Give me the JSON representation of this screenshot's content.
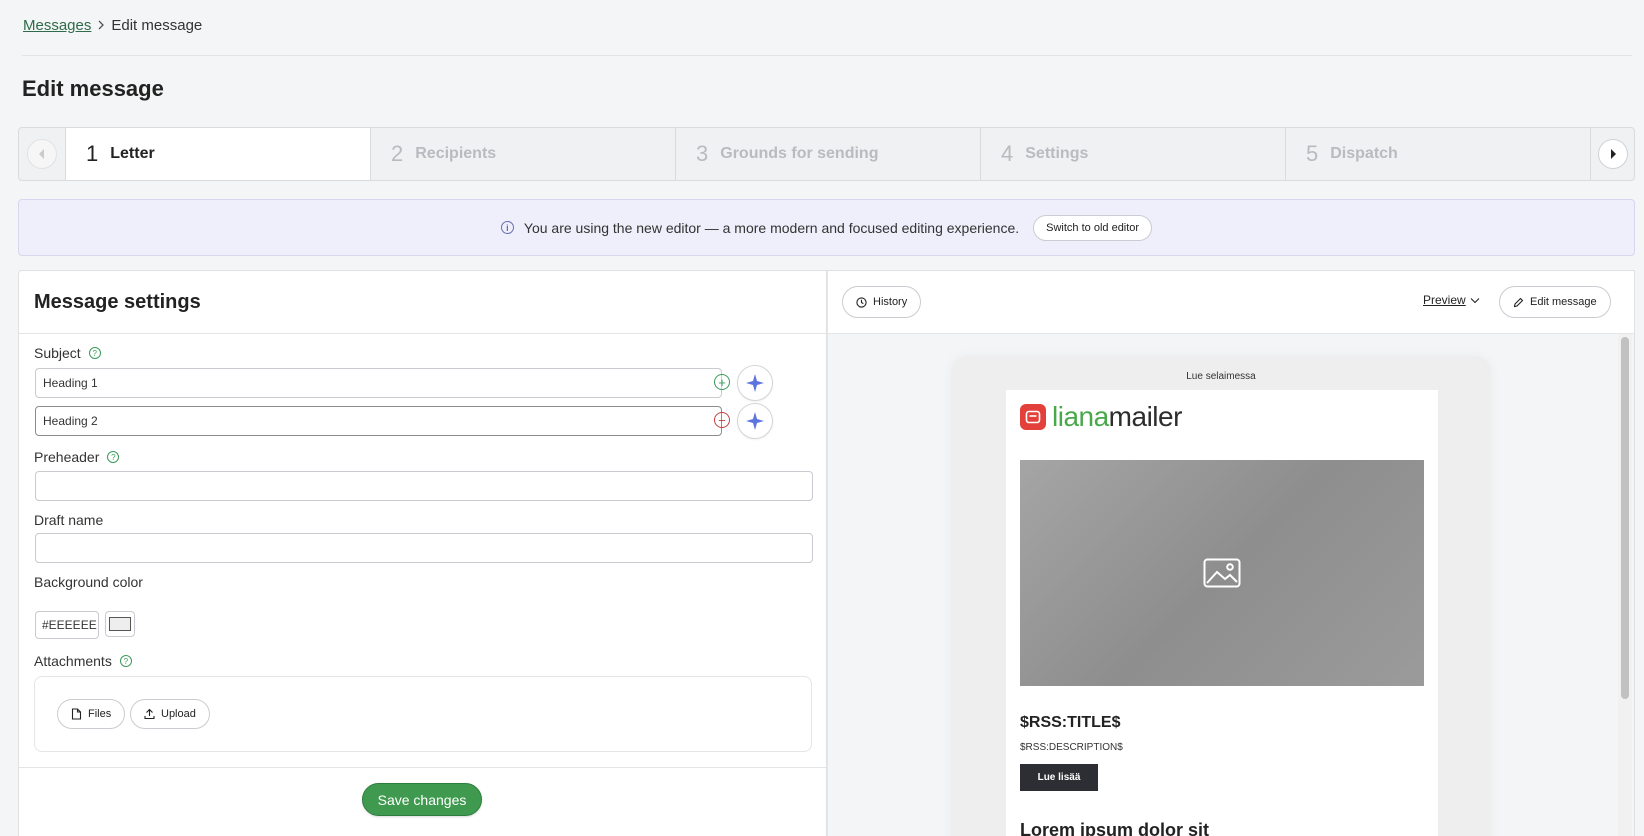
{
  "breadcrumb": {
    "parent": "Messages",
    "current": "Edit message"
  },
  "page_title": "Edit message",
  "stepper": {
    "steps": [
      {
        "num": "1",
        "label": "Letter"
      },
      {
        "num": "2",
        "label": "Recipients"
      },
      {
        "num": "3",
        "label": "Grounds for sending"
      },
      {
        "num": "4",
        "label": "Settings"
      },
      {
        "num": "5",
        "label": "Dispatch"
      }
    ],
    "active_index": 0
  },
  "notice": {
    "text": "You are using the new editor — a more modern and focused editing experience.",
    "button": "Switch to old editor"
  },
  "settings": {
    "title": "Message settings",
    "subject_label": "Subject",
    "subject_1": "Heading 1",
    "subject_2": "Heading 2",
    "preheader_label": "Preheader",
    "preheader_value": "",
    "draft_name_label": "Draft name",
    "draft_name_value": "",
    "bg_color_label": "Background color",
    "bg_color_value": "#EEEEEE",
    "attachments_label": "Attachments",
    "files_button": "Files",
    "upload_button": "Upload",
    "save_button": "Save changes"
  },
  "preview": {
    "history_button": "History",
    "preview_dropdown": "Preview",
    "edit_button": "Edit message",
    "browser_link": "Lue selaimessa",
    "logo_a": "liana",
    "logo_b": "mailer",
    "rss_title": "$RSS:TITLE$",
    "rss_description": "$RSS:DESCRIPTION$",
    "read_more": "Lue lisää",
    "lorem": "Lorem ipsum dolor sit"
  },
  "colors": {
    "accent_green": "#3f9a4f",
    "link_green": "#2e6b4a",
    "danger_red": "#c8403f",
    "notice_bg": "#efeffb",
    "logo_red": "#e3403b"
  }
}
